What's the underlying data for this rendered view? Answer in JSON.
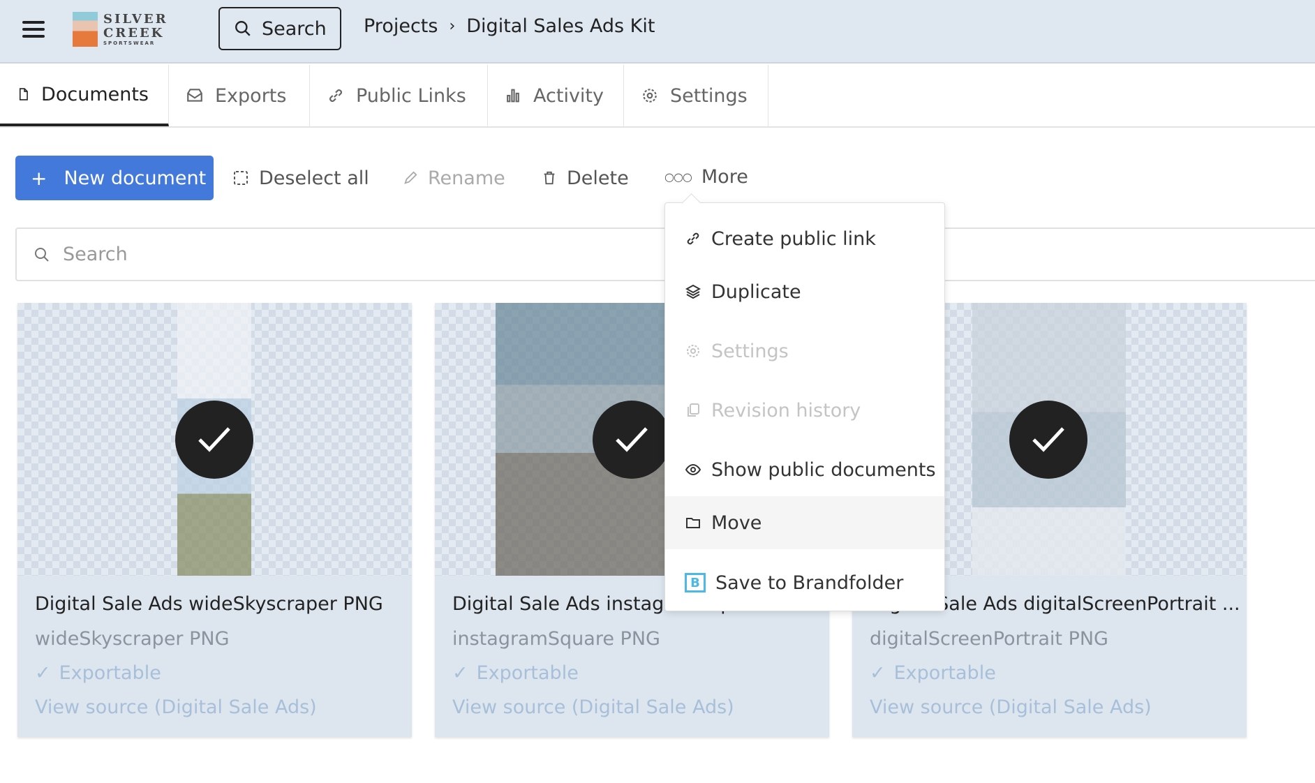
{
  "header": {
    "logo_text": "SILVER CREEK",
    "logo_sub": "SPORTSWEAR",
    "search_label": "Search",
    "breadcrumb": [
      "Projects",
      "Digital Sales Ads Kit"
    ],
    "breadcrumb_sep": "›"
  },
  "tabs": [
    {
      "label": "Documents",
      "icon": "document-icon",
      "active": true
    },
    {
      "label": "Exports",
      "icon": "inbox-icon"
    },
    {
      "label": "Public Links",
      "icon": "link-icon"
    },
    {
      "label": "Activity",
      "icon": "bar-chart-icon"
    },
    {
      "label": "Settings",
      "icon": "gear-icon"
    }
  ],
  "toolbar": {
    "new_document": "New document",
    "deselect_all": "Deselect all",
    "rename": "Rename",
    "delete": "Delete",
    "more": "More"
  },
  "search": {
    "placeholder": "Search"
  },
  "cards": [
    {
      "title": "Digital Sale Ads wideSkyscraper PNG",
      "subtitle": "wideSkyscraper PNG",
      "status": "Exportable",
      "source": "View source (Digital Sale Ads)",
      "selected": true
    },
    {
      "title": "Digital Sale Ads instagramSquare PNG",
      "subtitle": "instagramSquare PNG",
      "status": "Exportable",
      "source": "View source (Digital Sale Ads)",
      "selected": true
    },
    {
      "title": "Digital Sale Ads digitalScreenPortrait ...",
      "subtitle": "digitalScreenPortrait PNG",
      "status": "Exportable",
      "source": "View source (Digital Sale Ads)",
      "selected": true
    }
  ],
  "menu": [
    {
      "label": "Create public link",
      "icon": "link-icon",
      "disabled": false
    },
    {
      "label": "Duplicate",
      "icon": "layers-icon",
      "disabled": false
    },
    {
      "label": "Settings",
      "icon": "gear-icon",
      "disabled": true
    },
    {
      "label": "Revision history",
      "icon": "copy-icon",
      "disabled": true
    },
    {
      "label": "Show public documents",
      "icon": "eye-icon",
      "disabled": false
    },
    {
      "label": "Move",
      "icon": "folder-icon",
      "disabled": false,
      "hovered": true
    },
    {
      "label": "Save to Brandfolder",
      "icon": "brandfolder-icon",
      "disabled": false
    }
  ],
  "colors": {
    "header_bg": "#dfe8f1",
    "primary": "#4479dc",
    "card_bg": "#dde6ef",
    "link": "#a7bfd8"
  }
}
